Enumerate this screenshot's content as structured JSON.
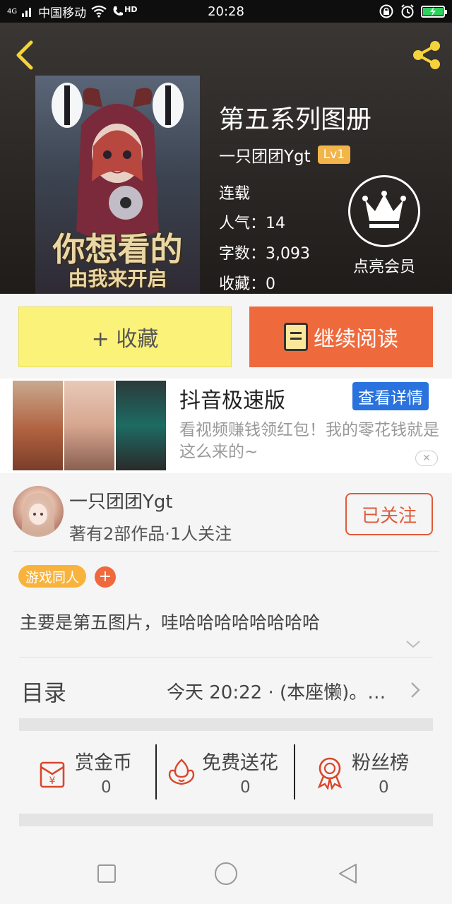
{
  "status_bar": {
    "signal": "4G",
    "carrier": "中国移动",
    "hd": "HD",
    "time": "20:28"
  },
  "book": {
    "title": "第五系列图册",
    "author": "一只团团Ygt",
    "level": "Lv1",
    "status": "连载",
    "popularity": "人气：14",
    "word_count": "字数：3,093",
    "favorites": "收藏：0",
    "cover_line1": "你想看的",
    "cover_line2": "由我来开启"
  },
  "vip": {
    "label": "点亮会员"
  },
  "actions": {
    "collect_label": "+ 收藏",
    "read_label": "继续阅读"
  },
  "ad": {
    "title": "抖音极速版",
    "button": "查看详情",
    "desc": "看视频赚钱领红包！我的零花钱就是这么来的~",
    "close": "✕"
  },
  "author_block": {
    "name": "一只团团Ygt",
    "works": "著有2部作品·1人关注",
    "follow_label": "已关注"
  },
  "tag": {
    "label": "游戏同人",
    "add": "+"
  },
  "description": "主要是第五图片，哇哈哈哈哈哈哈哈哈",
  "toc": {
    "title": "目录",
    "latest": "今天 20:22 · (本座懒)。…"
  },
  "stats": [
    {
      "label": "赏金币",
      "value": "0",
      "icon": "red-envelope-icon"
    },
    {
      "label": "免费送花",
      "value": "0",
      "icon": "flower-icon"
    },
    {
      "label": "粉丝榜",
      "value": "0",
      "icon": "medal-icon"
    }
  ],
  "colors": {
    "collect_bg": "#fbf279",
    "read_bg": "#ee6a3d",
    "accent_red": "#e05a3a",
    "lv_badge": "#f2b54a",
    "tag_bg": "#f8b33c",
    "ad_button": "#2a72dd"
  }
}
